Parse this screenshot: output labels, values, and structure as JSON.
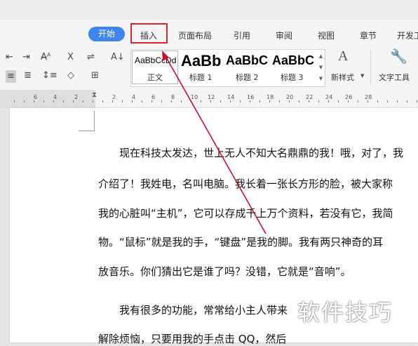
{
  "menu": {
    "start": "开始",
    "insert": "插入",
    "layout": "页面布局",
    "references": "引用",
    "review": "审阅",
    "view": "视图",
    "sections": "章节",
    "developer": "开发工"
  },
  "styles": {
    "previews": [
      "AaBbCcDd",
      "AaBb",
      "AaBbC",
      "AaBbC"
    ],
    "labels": [
      "正文",
      "标题 1",
      "标题 2",
      "标题 3"
    ],
    "new_style": "新样式",
    "text_tools": "文字工具"
  },
  "ruler": {
    "numbers": [
      "6",
      "4",
      "2",
      "2",
      "4",
      "6",
      "8",
      "10",
      "12",
      "14",
      "16",
      "18",
      "20",
      "22",
      "24",
      "26",
      "28"
    ]
  },
  "document": {
    "lines": [
      "现在科技太发达，世上无人不知大名鼎鼎的我！哦，对了，我",
      "介绍了！我姓电，名叫电脑。我长着一张长方形的脸，被大家称",
      "我的心脏叫“主机”，它可以存成千上万个资料，若没有它，我简",
      "物。“鼠标”就是我的手，“键盘”是我的脚。我有两只神奇的耳",
      "放音乐。你们猜出它是谁了吗？没错，它就是“音响”。",
      "我有很多的功能，常常给小主人带来",
      "解除烦恼，只要用我的手点击 QQ，然后"
    ]
  },
  "watermark": "软件技巧",
  "colors": {
    "start_button": "#3d86f0",
    "highlight_box": "#d9262b",
    "annotation_arrow": "#c8102e"
  }
}
